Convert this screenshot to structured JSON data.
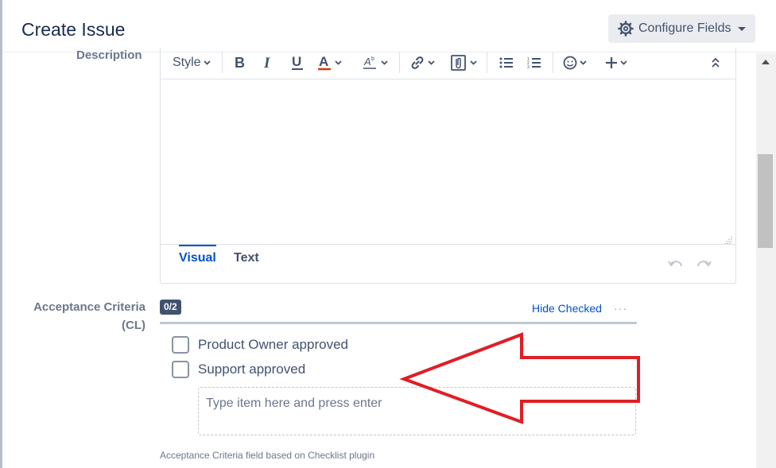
{
  "dialog": {
    "title": "Create Issue",
    "configure_fields_label": "Configure Fields"
  },
  "description": {
    "label": "Description",
    "toolbar": {
      "style_label": "Style",
      "text_color": "#de350b"
    },
    "modes": [
      "Visual",
      "Text"
    ],
    "active_mode": "Visual"
  },
  "acceptance": {
    "label_line1": "Acceptance Criteria",
    "label_line2": "(CL)",
    "badge": "0/2",
    "hide_checked": "Hide Checked",
    "more": "···",
    "items": [
      {
        "label": "Product Owner approved",
        "checked": false
      },
      {
        "label": "Support approved",
        "checked": false
      }
    ],
    "new_item_placeholder": "Type item here and press enter",
    "helper_text": "Acceptance Criteria field based on Checklist plugin"
  },
  "annotation": {
    "arrow_color": "#e01e25"
  },
  "colors": {
    "link": "#0052cc",
    "label": "#6b778c",
    "badge_bg": "#42526e"
  }
}
